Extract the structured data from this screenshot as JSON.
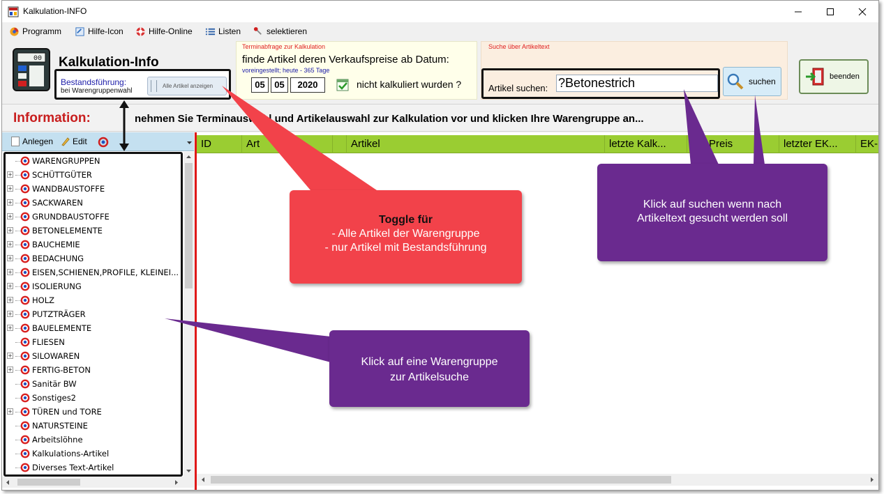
{
  "window": {
    "title": "Kalkulation-INFO"
  },
  "menu": [
    {
      "label": "Programm",
      "icon": "program-icon"
    },
    {
      "label": "Hilfe-Icon",
      "icon": "help-icon"
    },
    {
      "label": "Hilfe-Online",
      "icon": "lifebuoy-icon"
    },
    {
      "label": "Listen",
      "icon": "list-icon"
    },
    {
      "label": "selektieren",
      "icon": "select-icon"
    }
  ],
  "header": {
    "title": "Kalkulation-Info",
    "bestand_label": "Bestandsführung:",
    "bestand_sub": "bei Warengruppenwahl",
    "toggle_label": "Alle Artikel anzeigen"
  },
  "termin": {
    "group_title": "Terminabfrage zur Kalkulation",
    "text": "finde Artikel deren Verkaufspreise ab Datum:",
    "preset": "voreingestellt; heute - 365 Tage",
    "day": "05",
    "month": "05",
    "year": "2020",
    "suffix": "nicht kalkuliert wurden ?"
  },
  "search": {
    "group_title": "Suche über Artikeltext",
    "label": "Artikel suchen:",
    "value": "?Betonestrich",
    "button": "suchen"
  },
  "exit_button": "beenden",
  "info": {
    "label": "Information:",
    "message": "nehmen Sie Terminauswahl und Artikelauswahl zur Kalkulation vor und klicken Ihre Warengruppe an..."
  },
  "tree_toolbar": {
    "add": "Anlegen",
    "edit": "Edit"
  },
  "tree": [
    {
      "label": "WARENGRUPPEN",
      "expandable": false
    },
    {
      "label": "SCHÜTTGÜTER",
      "expandable": true
    },
    {
      "label": "WANDBAUSTOFFE",
      "expandable": true
    },
    {
      "label": "SACKWAREN",
      "expandable": true
    },
    {
      "label": "GRUNDBAUSTOFFE",
      "expandable": true
    },
    {
      "label": "BETONELEMENTE",
      "expandable": true
    },
    {
      "label": "BAUCHEMIE",
      "expandable": true
    },
    {
      "label": "BEDACHUNG",
      "expandable": true
    },
    {
      "label": "EISEN,SCHIENEN,PROFILE, KLEINEI...",
      "expandable": true
    },
    {
      "label": "ISOLIERUNG",
      "expandable": true
    },
    {
      "label": "HOLZ",
      "expandable": true
    },
    {
      "label": "PUTZTRÄGER",
      "expandable": true
    },
    {
      "label": "BAUELEMENTE",
      "expandable": true
    },
    {
      "label": "FLIESEN",
      "expandable": false
    },
    {
      "label": "SILOWAREN",
      "expandable": true
    },
    {
      "label": "FERTIG-BETON",
      "expandable": true
    },
    {
      "label": "Sanitär BW",
      "expandable": false
    },
    {
      "label": "Sonstiges2",
      "expandable": false
    },
    {
      "label": "TÜREN und TORE",
      "expandable": true
    },
    {
      "label": "NATURSTEINE",
      "expandable": false
    },
    {
      "label": "Arbeitslöhne",
      "expandable": false
    },
    {
      "label": "Kalkulations-Artikel",
      "expandable": false
    },
    {
      "label": "Diverses Text-Artikel",
      "expandable": false
    }
  ],
  "grid": {
    "columns": [
      "ID",
      "Art",
      "Artikel",
      "letzte  Kalk...",
      "EK-Preis",
      "letzter  EK...",
      "EK-"
    ]
  },
  "callouts": {
    "toggle_title": "Toggle für",
    "toggle_line1": "-  Alle Artikel der Warengruppe",
    "toggle_line2": "- nur Artikel mit Bestandsführung",
    "search_line1": "Klick auf suchen wenn nach",
    "search_line2": "Artikeltext gesucht werden soll",
    "tree_line1": "Klick auf eine Warengruppe",
    "tree_line2": "zur Artikelsuche"
  },
  "colors": {
    "grid_header": "#9acd32",
    "callout_red": "#f2424a",
    "callout_purple": "#6a2a8f",
    "info_label": "#c81e1e"
  }
}
